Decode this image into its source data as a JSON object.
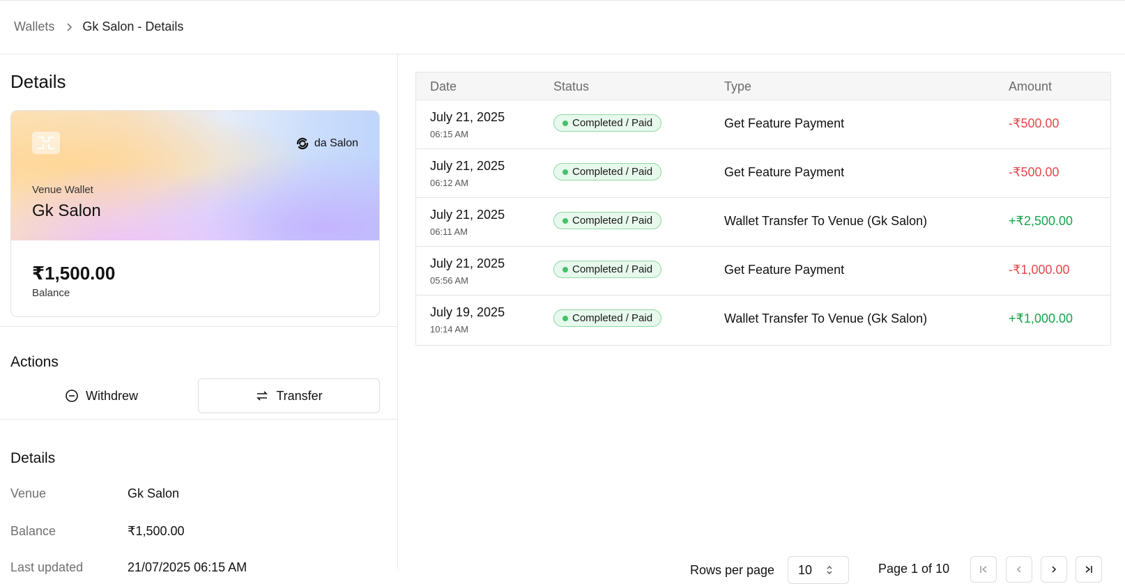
{
  "breadcrumb": {
    "parent": "Wallets",
    "current": "Gk Salon - Details"
  },
  "left": {
    "title": "Details",
    "card": {
      "brand": "da Salon",
      "label": "Venue Wallet",
      "name": "Gk Salon",
      "balance": "₹1,500.00",
      "balance_label": "Balance"
    },
    "actions": {
      "title": "Actions",
      "withdraw_label": "Withdrew",
      "transfer_label": "Transfer"
    },
    "details": {
      "title": "Details",
      "rows": [
        {
          "key": "Venue",
          "value": "Gk Salon"
        },
        {
          "key": "Balance",
          "value": "₹1,500.00"
        },
        {
          "key": "Last updated",
          "value": "21/07/2025 06:15 AM"
        }
      ]
    }
  },
  "table": {
    "headers": [
      "Date",
      "Status",
      "Type",
      "Amount"
    ],
    "rows": [
      {
        "date": "July 21, 2025",
        "time": "06:15 AM",
        "status": "Completed / Paid",
        "type": "Get Feature Payment",
        "amount": "-₹500.00",
        "sign": "neg"
      },
      {
        "date": "July 21, 2025",
        "time": "06:12 AM",
        "status": "Completed / Paid",
        "type": "Get Feature Payment",
        "amount": "-₹500.00",
        "sign": "neg"
      },
      {
        "date": "July 21, 2025",
        "time": "06:11 AM",
        "status": "Completed / Paid",
        "type": "Wallet Transfer To Venue (Gk Salon)",
        "amount": "+₹2,500.00",
        "sign": "pos"
      },
      {
        "date": "July 21, 2025",
        "time": "05:56 AM",
        "status": "Completed / Paid",
        "type": "Get Feature Payment",
        "amount": "-₹1,000.00",
        "sign": "neg"
      },
      {
        "date": "July 19, 2025",
        "time": "10:14 AM",
        "status": "Completed / Paid",
        "type": "Wallet Transfer To Venue (Gk Salon)",
        "amount": "+₹1,000.00",
        "sign": "pos"
      }
    ]
  },
  "pagination": {
    "rows_per_page_label": "Rows per page",
    "rows_per_page_value": "10",
    "page_info": "Page 1 of 10"
  },
  "colors": {
    "negative": "#e5484d",
    "positive": "#18a34a",
    "badge_border": "#8fd7a4"
  }
}
